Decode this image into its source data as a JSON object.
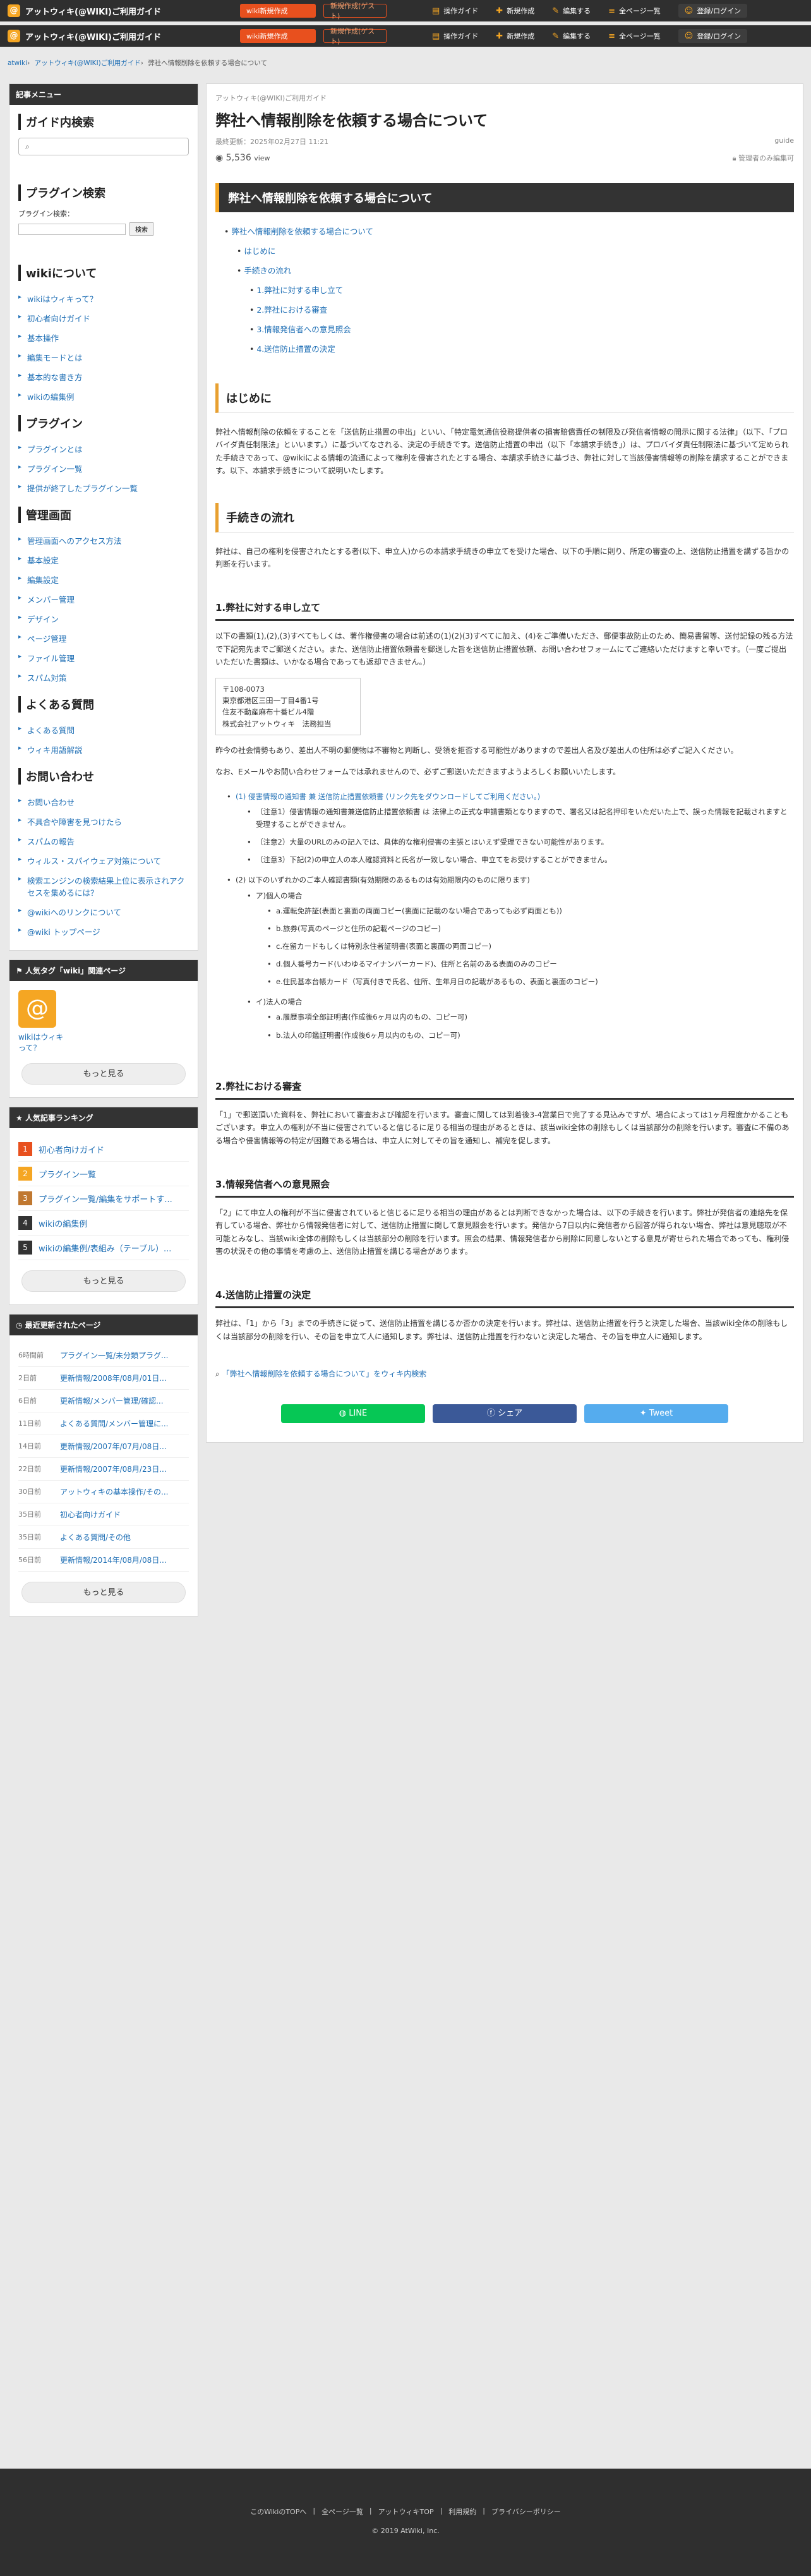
{
  "topbar": {
    "site_title": "アットウィキ(@WIKI)ご利用ガイド",
    "create_wiki": "wiki新規作成",
    "guest_editor": "新規作成(ゲスト)",
    "items": [
      "操作ガイド",
      "新規作成",
      "編集する",
      "全ページ一覧",
      "登録/ログイン"
    ]
  },
  "breadcrumb": [
    "atwiki",
    "アットウィキ(@WIKI)ご利用ガイド",
    "弊社へ情報削除を依頼する場合について"
  ],
  "sidebar": {
    "menu_title": "記事メニュー",
    "guide_search": "ガイド内検索",
    "plugin_search": "プラグイン検索",
    "plugin_search_label": "プラグイン検索：",
    "search_btn": "検索",
    "about_wiki": "wikiについて",
    "about_wiki_items": [
      "wikiはウィキって？",
      "初心者向けガイド",
      "基本操作",
      "編集モードとは",
      "基本的な書き方",
      "wikiの編集例"
    ],
    "plugin": "プラグイン",
    "plugin_items": [
      "プラグインとは",
      "プラグイン一覧",
      "提供が終了したプラグイン一覧"
    ],
    "admin": "管理画面",
    "admin_items": [
      "管理画面へのアクセス方法",
      "基本設定",
      "編集設定",
      "メンバー管理",
      "デザイン",
      "ページ管理",
      "ファイル管理",
      "スパム対策"
    ],
    "faq": "よくある質問",
    "faq_items": [
      "よくある質問",
      "ウィキ用語解説"
    ],
    "contact": "お問い合わせ",
    "contact_items": [
      "お問い合わせ",
      "不具合や障害を見つけたら",
      "スパムの報告",
      "ウィルス・スパイウェア対策について",
      "検索エンジンの検索結果上位に表示されアクセスを集めるには？",
      "@wikiへのリンクについて",
      "@wiki トップページ"
    ],
    "tag_title": "人気タグ「wiki」関連ページ",
    "tag_item": "wikiはウィキって？",
    "more": "もっと見る",
    "ranking_title": "人気記事ランキング",
    "ranking": [
      "初心者向けガイド",
      "プラグイン一覧",
      "プラグイン一覧/編集をサポートす...",
      "wikiの編集例",
      "wikiの編集例/表組み（テーブル）..."
    ],
    "recent_title": "最近更新されたページ",
    "recent": [
      {
        "time": "6時間前",
        "title": "プラグイン一覧/未分類プラグ..."
      },
      {
        "time": "2日前",
        "title": "更新情報/2008年/08月/01日..."
      },
      {
        "time": "6日前",
        "title": "更新情報/メンバー管理/確認..."
      },
      {
        "time": "11日前",
        "title": "よくある質問/メンバー管理に..."
      },
      {
        "time": "14日前",
        "title": "更新情報/2007年/07月/08日..."
      },
      {
        "time": "22日前",
        "title": "更新情報/2007年/08月/23日..."
      },
      {
        "time": "30日前",
        "title": "アットウィキの基本操作/その..."
      },
      {
        "time": "35日前",
        "title": "初心者向けガイド"
      },
      {
        "time": "35日前",
        "title": "よくある質問/その他"
      },
      {
        "time": "56日前",
        "title": "更新情報/2014年/08月/08日..."
      }
    ]
  },
  "main": {
    "site_name": "アットウィキ(@WIKI)ご利用ガイド",
    "title": "弊社へ情報削除を依頼する場合について",
    "updated": "最終更新：2025年02月27日 11:21",
    "guide": "guide",
    "views": "5,536",
    "views_unit": "view",
    "admin_edit": "管理者のみ編集可",
    "header_bar": "弊社へ情報削除を依頼する場合について",
    "toc": [
      "弊社へ情報削除を依頼する場合について",
      "はじめに",
      "手続きの流れ",
      "1.弊社に対する申し立て",
      "2.弊社における審査",
      "3.情報発信者への意見照会",
      "4.送信防止措置の決定"
    ],
    "h_intro": "はじめに",
    "intro": "弊社へ情報削除の依頼をすることを「送信防止措置の申出」といい、「特定電気通信役務提供者の損害賠償責任の制限及び発信者情報の開示に関する法律」（以下、「プロバイダ責任制限法」といいます。）に基づいてなされる、決定の手続きです。送信防止措置の申出（以下「本請求手続き」）は、プロバイダ責任制限法に基づいて定められた手続きであって、@wikiによる情報の流通によって権利を侵害されたとする場合、本請求手続きに基づき、弊社に対して当該侵害情報等の削除を請求することができます。以下、本請求手続きについて説明いたします。",
    "h_flow": "手続きの流れ",
    "flow": "弊社は、自己の権利を侵害されたとする者(以下、申立人)からの本請求手続きの申立てを受けた場合、以下の手順に則り、所定の審査の上、送信防止措置を講ずる旨かの判断を行います。",
    "h1": "1.弊社に対する申し立て",
    "p1a": "以下の書類(1),(2),(3)すべてもしくは、著作権侵害の場合は前述の(1)(2)(3)すべてに加え、(4)をご準備いただき、郵便事故防止のため、簡易書留等、送付記録の残る方法で下記宛先までご郵送ください。また、送信防止措置依頼書を郵送した旨を送信防止措置依頼、お問い合わせフォームにてご連絡いただけますと幸いです。（一度ご提出いただいた書類は、いかなる場合であっても返却できません。）",
    "addr": [
      "〒108-0073",
      "東京都港区三田一丁目4番1号",
      "住友不動産麻布十番ビル4階",
      "株式会社アットウィキ　法務担当"
    ],
    "p1b": "昨今の社会情勢もあり、差出人不明の郵便物は不審物と判断し、受領を拒否する可能性がありますので差出人名及び差出人の住所は必ずご記入ください。",
    "p1c": "なお、Eメールやお問い合わせフォームでは承れませんので、必ずご郵送いただきますようよろしくお願いいたします。",
    "items1": [
      "(1) 侵害情報の通知書 兼 送信防止措置依頼書 (リンク先をダウンロードしてご利用ください。)",
      "（注意1）侵害情報の通知書兼送信防止措置依頼書 は 法律上の正式な申請書類となりますので、署名又は記名押印をいただいた上で、誤った情報を記載されますと受理することができません。",
      "（注意2）大量のURLのみの記入では、具体的な権利侵害の主張とはいえず受理できない可能性があります。",
      "（注意3）下記(2)の申立人の本人確認資料と氏名が一致しない場合、申立てをお受けすることができません。",
      "(2) 以下のいずれかのご本人確認書類(有効期限のあるものは有効期限内のものに限ります)",
      "ア)個人の場合",
      "a.運転免許証(表面と裏面の両面コピー(裏面に記載のない場合であっても必ず両面とも))",
      "b.旅券(写真のページと住所の記載ページのコピー)",
      "c.在留カードもしくは特別永住者証明書(表面と裏面の両面コピー)",
      "d.個人番号カード(いわゆるマイナンバーカード)、住所と名前のある表面のみのコピー",
      "e.住民基本台帳カード（写真付きで氏名、住所、生年月日の記載があるもの、表面と裏面のコピー)",
      "イ)法人の場合",
      "a.履歴事項全部証明書(作成後6ヶ月以内のもの、コピー可)",
      "b.法人の印鑑証明書(作成後6ヶ月以内のもの、コピー可)"
    ],
    "h2": "2.弊社における審査",
    "p2": "「1」で郵送頂いた資料を、弊社において審査および確認を行います。審査に関しては到着後3-4営業日で完了する見込みですが、場合によっては1ヶ月程度かかることもございます。申立人の権利が不当に侵害されていると信じるに足りる相当の理由があるときは、該当wiki全体の削除もしくは当該部分の削除を行います。審査に不備のある場合や侵害情報等の特定が困難である場合は、申立人に対してその旨を通知し、補完を促します。",
    "h3": "3.情報発信者への意見照会",
    "p3": "「2」にて申立人の権利が不当に侵害されていると信じるに足りる相当の理由があるとは判断できなかった場合は、以下の手続きを行います。弊社が発信者の連絡先を保有している場合、弊社から情報発信者に対して、送信防止措置に関して意見照会を行います。発信から7日以内に発信者から回答が得られない場合、弊社は意見聴取が不可能とみなし、当該wiki全体の削除もしくは当該部分の削除を行います。照会の結果、情報発信者から削除に同意しないとする意見が寄せられた場合であっても、権利侵害の状況その他の事情を考慮の上、送信防止措置を講じる場合があります。",
    "h4": "4.送信防止措置の決定",
    "p4": "弊社は、「1」から「3」までの手続きに従って、送信防止措置を講じるか否かの決定を行います。弊社は、送信防止措置を行うと決定した場合、当該wiki全体の削除もしくは当該部分の削除を行い、その旨を申立て人に通知します。弊社は、送信防止措置を行わないと決定した場合、その旨を申立人に通知します。",
    "embed": "「弊社へ情報削除を依頼する場合について」をウィキ内検索",
    "share": [
      "LINE",
      "シェア",
      "Tweet"
    ]
  },
  "footer": {
    "links": [
      "このWikiのTOPへ",
      "全ページ一覧",
      "アットウィキTOP",
      "利用規約",
      "プライバシーポリシー"
    ],
    "copyright": "2019 AtWiki, Inc."
  },
  "colors": {
    "accent": "#e8501e",
    "brand": "#f5a623",
    "dark": "#2f2f2f",
    "line": "#06c755",
    "facebook": "#3b5998",
    "twitter": "#55acee"
  }
}
